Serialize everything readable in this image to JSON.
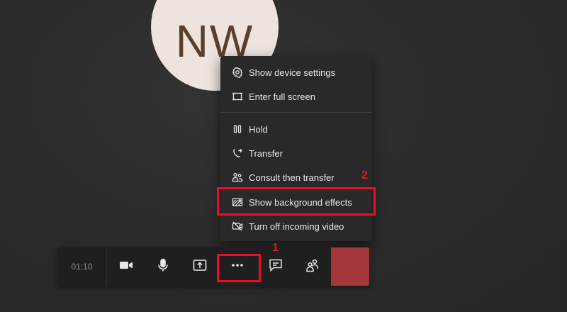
{
  "participant": {
    "initials": "NW"
  },
  "menu": {
    "items": [
      {
        "label": "Show device settings",
        "icon": "gear-icon"
      },
      {
        "label": "Enter full screen",
        "icon": "fullscreen-icon"
      },
      {
        "label": "Hold",
        "icon": "pause-icon"
      },
      {
        "label": "Transfer",
        "icon": "transfer-icon"
      },
      {
        "label": "Consult then transfer",
        "icon": "consult-transfer-icon"
      },
      {
        "label": "Show background effects",
        "icon": "background-effects-icon"
      },
      {
        "label": "Turn off incoming video",
        "icon": "video-off-icon"
      }
    ]
  },
  "toolbar": {
    "timer": "01:10",
    "buttons": [
      "camera-icon",
      "microphone-icon",
      "share-screen-icon",
      "more-options-icon",
      "chat-icon",
      "participants-icon",
      "hang-up-icon"
    ]
  },
  "annotations": {
    "step1": "1",
    "step2": "2",
    "color": "#e81123"
  },
  "colors": {
    "hangup": "#a4373a",
    "menu_bg": "#292929",
    "toolbar_bg": "#1f1f1f",
    "avatar_bg": "#eee4dd"
  }
}
